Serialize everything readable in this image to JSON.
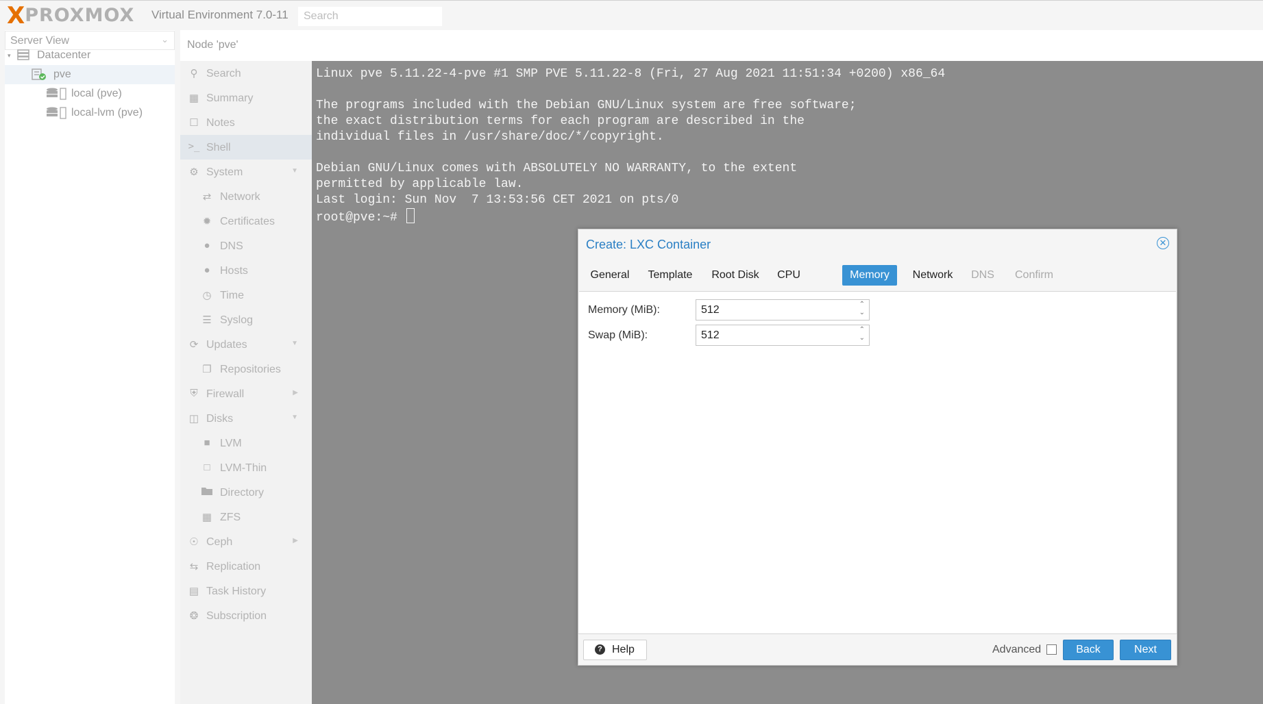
{
  "app": {
    "logo_x": "X",
    "logo_word": "PROXMOX",
    "version": "Virtual Environment 7.0-11",
    "search_placeholder": "Search"
  },
  "tree": {
    "view_label": "Server View",
    "items": [
      {
        "label": "Datacenter",
        "icon": "datacenter-icon"
      },
      {
        "label": "pve",
        "icon": "node-online-icon"
      },
      {
        "label": "local (pve)",
        "icon": "storage-icon"
      },
      {
        "label": "local-lvm (pve)",
        "icon": "storage-icon"
      }
    ]
  },
  "node_header": "Node 'pve'",
  "nav": {
    "items": [
      {
        "label": "Search",
        "icon": "search-icon"
      },
      {
        "label": "Summary",
        "icon": "summary-icon"
      },
      {
        "label": "Notes",
        "icon": "notes-icon"
      },
      {
        "label": "Shell",
        "icon": "terminal-icon",
        "active": true
      },
      {
        "label": "System",
        "icon": "gears-icon",
        "expandable": true
      },
      {
        "label": "Network",
        "icon": "network-icon"
      },
      {
        "label": "Certificates",
        "icon": "certificate-icon"
      },
      {
        "label": "DNS",
        "icon": "globe-icon"
      },
      {
        "label": "Hosts",
        "icon": "globe-icon"
      },
      {
        "label": "Time",
        "icon": "clock-icon"
      },
      {
        "label": "Syslog",
        "icon": "list-icon"
      },
      {
        "label": "Updates",
        "icon": "refresh-icon",
        "expandable": true
      },
      {
        "label": "Repositories",
        "icon": "files-icon"
      },
      {
        "label": "Firewall",
        "icon": "shield-icon",
        "submenu": true
      },
      {
        "label": "Disks",
        "icon": "hdd-icon",
        "expandable": true
      },
      {
        "label": "LVM",
        "icon": "square-icon"
      },
      {
        "label": "LVM-Thin",
        "icon": "square-outline-icon"
      },
      {
        "label": "Directory",
        "icon": "folder-icon"
      },
      {
        "label": "ZFS",
        "icon": "grid-icon"
      },
      {
        "label": "Ceph",
        "icon": "ceph-icon",
        "submenu": true
      },
      {
        "label": "Replication",
        "icon": "retweet-icon"
      },
      {
        "label": "Task History",
        "icon": "tasklist-icon"
      },
      {
        "label": "Subscription",
        "icon": "support-icon"
      }
    ]
  },
  "console": {
    "lines": [
      "Linux pve 5.11.22-4-pve #1 SMP PVE 5.11.22-8 (Fri, 27 Aug 2021 11:51:34 +0200) x86_64",
      "",
      "The programs included with the Debian GNU/Linux system are free software;",
      "the exact distribution terms for each program are described in the",
      "individual files in /usr/share/doc/*/copyright.",
      "",
      "Debian GNU/Linux comes with ABSOLUTELY NO WARRANTY, to the extent",
      "permitted by applicable law.",
      "Last login: Sun Nov  7 13:53:56 CET 2021 on pts/0"
    ],
    "prompt": "root@pve:~# "
  },
  "dialog": {
    "title": "Create: LXC Container",
    "tabs": [
      {
        "label": "General",
        "state": "normal"
      },
      {
        "label": "Template",
        "state": "normal"
      },
      {
        "label": "Root Disk",
        "state": "normal"
      },
      {
        "label": "CPU",
        "state": "normal"
      },
      {
        "label": "Memory",
        "state": "active"
      },
      {
        "label": "Network",
        "state": "normal"
      },
      {
        "label": "DNS",
        "state": "disabled"
      },
      {
        "label": "Confirm",
        "state": "disabled"
      }
    ],
    "fields": [
      {
        "label": "Memory (MiB):",
        "value": "512"
      },
      {
        "label": "Swap (MiB):",
        "value": "512"
      }
    ],
    "footer": {
      "help_label": "Help",
      "advanced_label": "Advanced",
      "back_label": "Back",
      "next_label": "Next"
    }
  },
  "colors": {
    "accent": "#3892d4",
    "brand_orange": "#e57000",
    "console_bg": "#8c8c8c"
  }
}
